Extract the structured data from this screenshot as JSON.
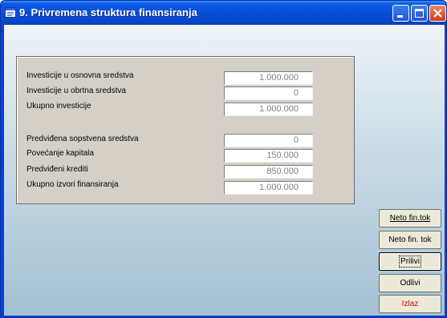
{
  "window": {
    "title": "9. Privremena struktura finansiranja"
  },
  "investments": [
    {
      "label": "Investicije u osnovna sredstva",
      "value": "1.000.000"
    },
    {
      "label": "Investicije u obrtna sredstva",
      "value": "0"
    },
    {
      "label": "Ukupno investicije",
      "value": "1.000.000"
    }
  ],
  "financing": [
    {
      "label": "Predviđena sopstvena sredstva",
      "value": "0"
    },
    {
      "label": "Povećanje kapitala",
      "value": "150.000"
    },
    {
      "label": "Predviđeni krediti",
      "value": "850.000"
    },
    {
      "label": "Ukupno izvori finansiranja",
      "value": "1.000.000"
    }
  ],
  "buttons": {
    "neto_fin_tok_1": "Neto fin.tok",
    "neto_fin_tok_2": "Neto fin. tok",
    "prilivi": "Prilivi",
    "odlivi": "Odlivi",
    "izlaz": "Izlaz"
  },
  "colors": {
    "title_bar": "#0a4fd8",
    "exit_text": "#e00000"
  },
  "icons": [
    "app-icon",
    "minimize-icon",
    "maximize-icon",
    "close-icon"
  ]
}
